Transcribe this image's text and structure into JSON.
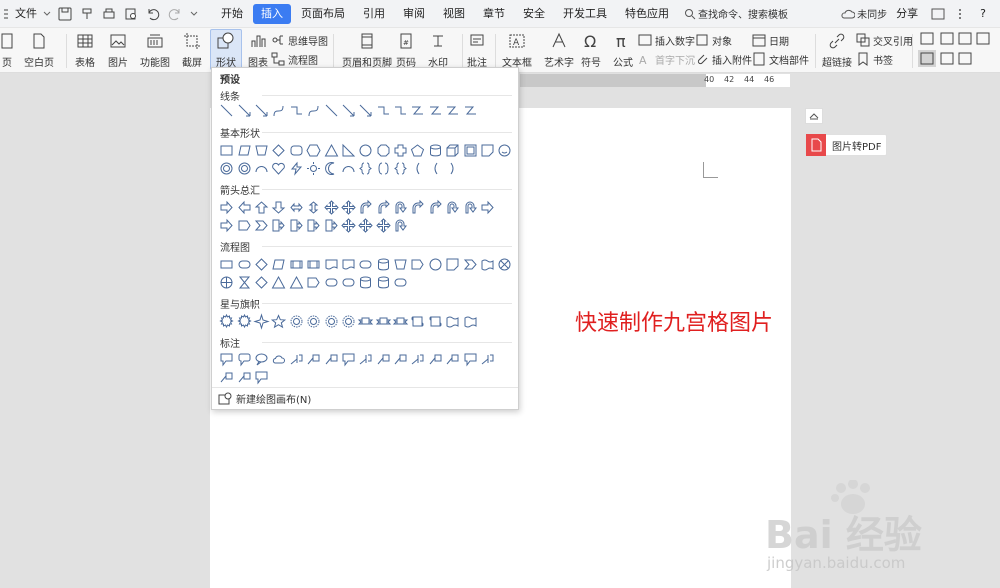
{
  "quick_access": {
    "file_label": "文件"
  },
  "tabs": [
    "开始",
    "插入",
    "页面布局",
    "引用",
    "审阅",
    "视图",
    "章节",
    "安全",
    "开发工具",
    "特色应用"
  ],
  "active_tab": "插入",
  "search": {
    "placeholder": "查找命令、搜索模板"
  },
  "top_right": {
    "sync": "未同步",
    "share": "分享",
    "help": "?"
  },
  "ribbon": {
    "page": "页",
    "blank_page": "空白页",
    "table": "表格",
    "picture": "图片",
    "function_chart": "功能图",
    "screenshot": "截屏",
    "shape": "形状",
    "chart": "图表",
    "mindmap": "思维导图",
    "flowchart": "流程图",
    "header_footer": "页眉和页脚",
    "page_number": "页码",
    "watermark": "水印",
    "comment": "批注",
    "textbox": "文本框",
    "wordart": "艺术字",
    "symbol": "符号",
    "formula": "公式",
    "insert_number": "插入数字",
    "object": "对象",
    "date": "日期",
    "first_char_sink": "首字下沉",
    "insert_attachment": "插入附件",
    "doc_parts": "文档部件",
    "hyperlink": "超链接",
    "cross_ref": "交叉引用",
    "bookmark": "书签"
  },
  "ruler_ticks": [
    "40",
    "42",
    "44",
    "46"
  ],
  "dropdown": {
    "preset": "预设",
    "sections": [
      "线条",
      "基本形状",
      "箭头总汇",
      "流程图",
      "星与旗帜",
      "标注"
    ],
    "new_canvas": "新建绘图画布(N)"
  },
  "side_panel": {
    "pdf_button": "图片转PDF"
  },
  "overlay_text": "快速制作九宫格图片",
  "watermark": {
    "brand": "Bai  经验",
    "url": "jingyan.baidu.com"
  },
  "colors": {
    "accent": "#3b7cf2",
    "overlay_red": "#e02020",
    "pdf_red": "#e8494b"
  }
}
